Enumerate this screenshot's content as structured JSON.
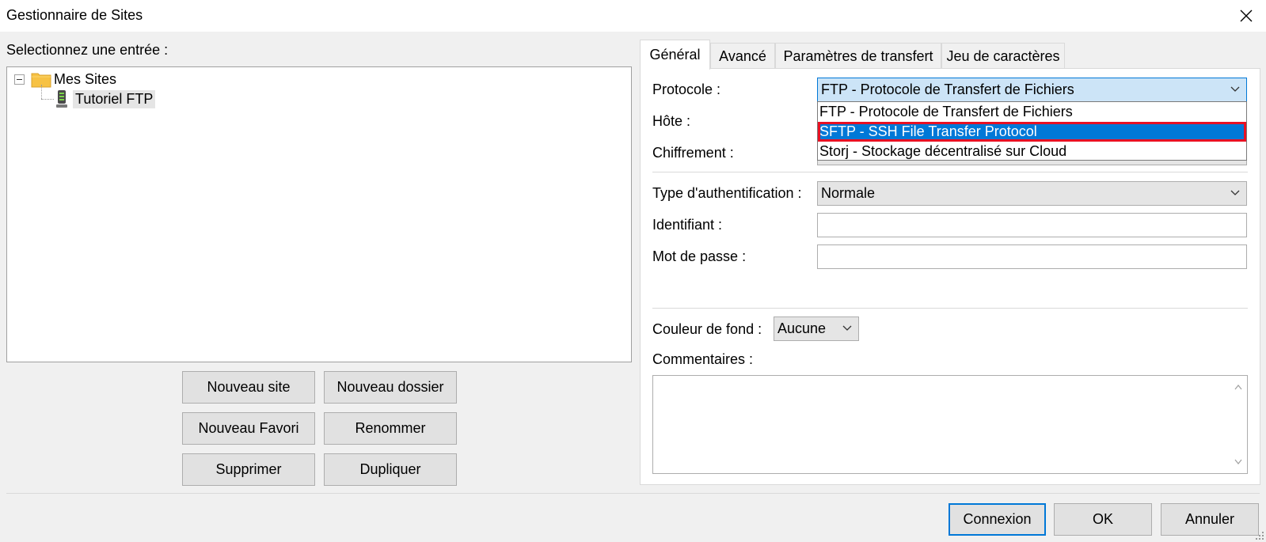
{
  "window": {
    "title": "Gestionnaire de Sites"
  },
  "left": {
    "select_label": "Selectionnez une entrée :",
    "tree": {
      "root_label": "Mes Sites",
      "site_label": "Tutoriel FTP"
    },
    "buttons": {
      "new_site": "Nouveau site",
      "new_folder": "Nouveau dossier",
      "new_bookmark": "Nouveau Favori",
      "rename": "Renommer",
      "delete": "Supprimer",
      "duplicate": "Dupliquer"
    }
  },
  "tabs": [
    {
      "label": "Général"
    },
    {
      "label": "Avancé"
    },
    {
      "label": "Paramètres de transfert"
    },
    {
      "label": "Jeu de caractères"
    }
  ],
  "general": {
    "protocol_label": "Protocole :",
    "protocol_value": "FTP - Protocole de Transfert de Fichiers",
    "protocol_options": [
      "FTP - Protocole de Transfert de Fichiers",
      "SFTP - SSH File Transfer Protocol",
      "Storj - Stockage décentralisé sur Cloud"
    ],
    "host_label": "Hôte :",
    "encryption_label": "Chiffrement :",
    "auth_label": "Type d'authentification :",
    "auth_value": "Normale",
    "user_label": "Identifiant :",
    "password_label": "Mot de passe :",
    "bgcolor_label": "Couleur de fond :",
    "bgcolor_value": "Aucune",
    "comments_label": "Commentaires :"
  },
  "footer": {
    "connect": "Connexion",
    "ok": "OK",
    "cancel": "Annuler"
  },
  "colors": {
    "accent": "#0078d7",
    "highlight_border": "#e81123",
    "folder": "#f7c244"
  }
}
